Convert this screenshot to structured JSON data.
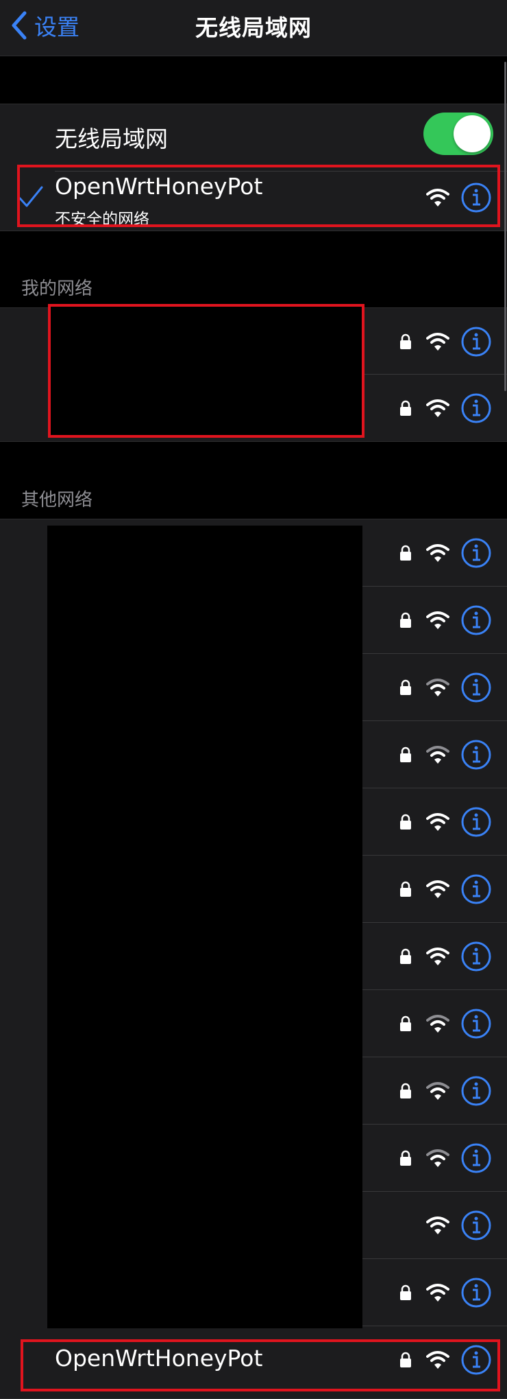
{
  "nav": {
    "back_label": "设置",
    "title": "无线局域网"
  },
  "wifi_toggle": {
    "label": "无线局域网",
    "state": "on"
  },
  "connected": {
    "ssid": "OpenWrtHoneyPot",
    "subtitle": "不安全的网络",
    "locked": false,
    "signal": "strong"
  },
  "sections": {
    "my_networks_header": "我的网络",
    "other_networks_header": "其他网络"
  },
  "my_networks": [
    {
      "name": "",
      "locked": true,
      "signal": "strong"
    },
    {
      "name": "",
      "locked": true,
      "signal": "strong"
    }
  ],
  "other_networks": [
    {
      "name": "",
      "locked": true,
      "signal": "strong"
    },
    {
      "name": "",
      "locked": true,
      "signal": "strong"
    },
    {
      "name": "",
      "locked": true,
      "signal": "weak"
    },
    {
      "name": "",
      "locked": true,
      "signal": "weak"
    },
    {
      "name": "",
      "locked": true,
      "signal": "strong"
    },
    {
      "name": "",
      "locked": true,
      "signal": "strong"
    },
    {
      "name": "",
      "locked": true,
      "signal": "strong"
    },
    {
      "name": "",
      "locked": true,
      "signal": "weak"
    },
    {
      "name": "",
      "locked": true,
      "signal": "weak"
    },
    {
      "name": "",
      "locked": true,
      "signal": "weak"
    },
    {
      "name": "",
      "locked": false,
      "signal": "strong"
    },
    {
      "name": "",
      "locked": true,
      "signal": "strong"
    },
    {
      "name": "OpenWrtHoneyPot",
      "locked": true,
      "signal": "strong"
    }
  ],
  "colors": {
    "accent": "#3a82f6",
    "toggle_on": "#34c759",
    "highlight_box": "#e0141e",
    "weak_signal": "#8e8e93"
  },
  "icons": {
    "back": "chevron-left-icon",
    "check": "checkmark-icon",
    "lock": "lock-icon",
    "wifi": "wifi-icon",
    "info": "info-icon"
  }
}
